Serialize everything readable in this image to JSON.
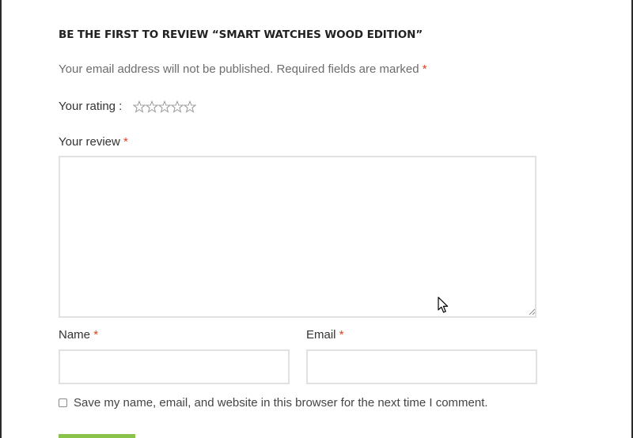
{
  "review_form": {
    "title": "BE THE FIRST TO REVIEW “SMART WATCHES WOOD EDITION”",
    "notes": "Your email address will not be published. Required fields are marked",
    "required_marker": "*",
    "rating_label": "Your rating :",
    "rating": {
      "value": 0,
      "max": 5
    },
    "review_label": "Your review",
    "review_value": "",
    "name_label": "Name",
    "name_value": "",
    "email_label": "Email",
    "email_value": "",
    "cookies_consent_label": "Save my name, email, and website in this browser for the next time I comment.",
    "cookies_consent_checked": false
  },
  "colors": {
    "required": "#e2401c",
    "field_border": "#e1e1e1",
    "submit_button": "#8bc34a",
    "star_outline": "#9a9a9a"
  },
  "icons": {
    "star": "star-outline-icon",
    "resize": "resize-grip-icon",
    "cursor": "mouse-pointer-icon"
  }
}
